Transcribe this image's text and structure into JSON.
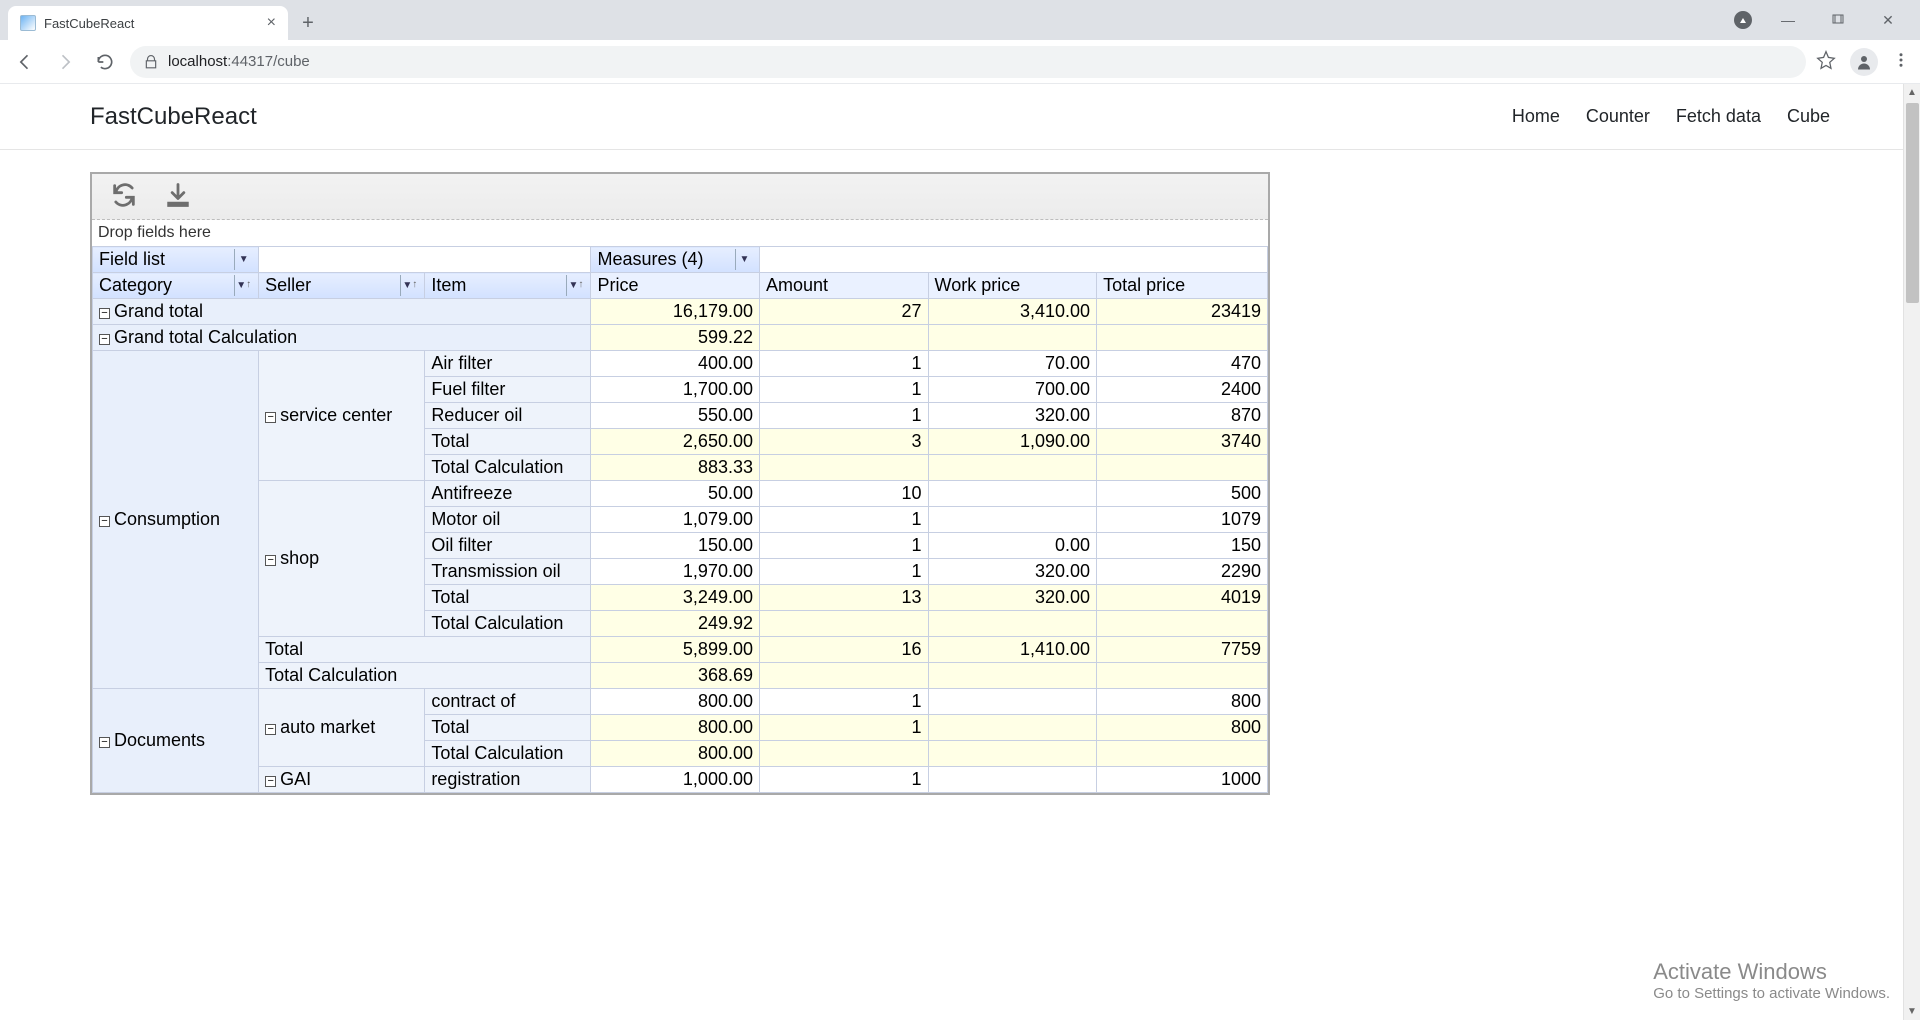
{
  "browser": {
    "tab_title": "FastCubeReact",
    "url_host": "localhost",
    "url_port_path": ":44317/cube"
  },
  "header": {
    "brand": "FastCubeReact",
    "nav": {
      "home": "Home",
      "counter": "Counter",
      "fetch": "Fetch data",
      "cube": "Cube"
    }
  },
  "cube": {
    "drop_zone": "Drop fields here",
    "field_list": "Field list",
    "measures": "Measures (4)",
    "columns": {
      "category": "Category",
      "seller": "Seller",
      "item": "Item",
      "price": "Price",
      "amount": "Amount",
      "work_price": "Work price",
      "total_price": "Total price"
    },
    "labels": {
      "grand_total": "Grand total",
      "grand_total_calc": "Grand total Calculation",
      "total": "Total",
      "total_calc": "Total Calculation"
    },
    "grand_total": {
      "price": "16,179.00",
      "amount": "27",
      "work_price": "3,410.00",
      "total_price": "23419"
    },
    "grand_total_calc": {
      "price": "599.22"
    },
    "categories": {
      "consumption": {
        "label": "Consumption",
        "sellers": {
          "service_center": {
            "label": "service center",
            "items": {
              "air_filter": {
                "label": "Air filter",
                "price": "400.00",
                "amount": "1",
                "work_price": "70.00",
                "total_price": "470"
              },
              "fuel_filter": {
                "label": "Fuel filter",
                "price": "1,700.00",
                "amount": "1",
                "work_price": "700.00",
                "total_price": "2400"
              },
              "reducer_oil": {
                "label": "Reducer oil",
                "price": "550.00",
                "amount": "1",
                "work_price": "320.00",
                "total_price": "870"
              }
            },
            "total": {
              "price": "2,650.00",
              "amount": "3",
              "work_price": "1,090.00",
              "total_price": "3740"
            },
            "total_calc": {
              "price": "883.33"
            }
          },
          "shop": {
            "label": "shop",
            "items": {
              "antifreeze": {
                "label": "Antifreeze",
                "price": "50.00",
                "amount": "10",
                "work_price": "",
                "total_price": "500"
              },
              "motor_oil": {
                "label": "Motor oil",
                "price": "1,079.00",
                "amount": "1",
                "work_price": "",
                "total_price": "1079"
              },
              "oil_filter": {
                "label": "Oil filter",
                "price": "150.00",
                "amount": "1",
                "work_price": "0.00",
                "total_price": "150"
              },
              "transmission_oil": {
                "label": "Transmission oil",
                "price": "1,970.00",
                "amount": "1",
                "work_price": "320.00",
                "total_price": "2290"
              }
            },
            "total": {
              "price": "3,249.00",
              "amount": "13",
              "work_price": "320.00",
              "total_price": "4019"
            },
            "total_calc": {
              "price": "249.92"
            }
          }
        },
        "total": {
          "price": "5,899.00",
          "amount": "16",
          "work_price": "1,410.00",
          "total_price": "7759"
        },
        "total_calc": {
          "price": "368.69"
        }
      },
      "documents": {
        "label": "Documents",
        "sellers": {
          "auto_market": {
            "label": "auto market",
            "items": {
              "contract_of": {
                "label": "contract of",
                "price": "800.00",
                "amount": "1",
                "work_price": "",
                "total_price": "800"
              }
            },
            "total": {
              "price": "800.00",
              "amount": "1",
              "work_price": "",
              "total_price": "800"
            },
            "total_calc": {
              "price": "800.00"
            }
          },
          "gai": {
            "label": "GAI",
            "items": {
              "registration": {
                "label": "registration",
                "price": "1,000.00",
                "amount": "1",
                "work_price": "",
                "total_price": "1000"
              }
            }
          }
        }
      }
    }
  },
  "watermark": {
    "line1": "Activate Windows",
    "line2": "Go to Settings to activate Windows."
  }
}
